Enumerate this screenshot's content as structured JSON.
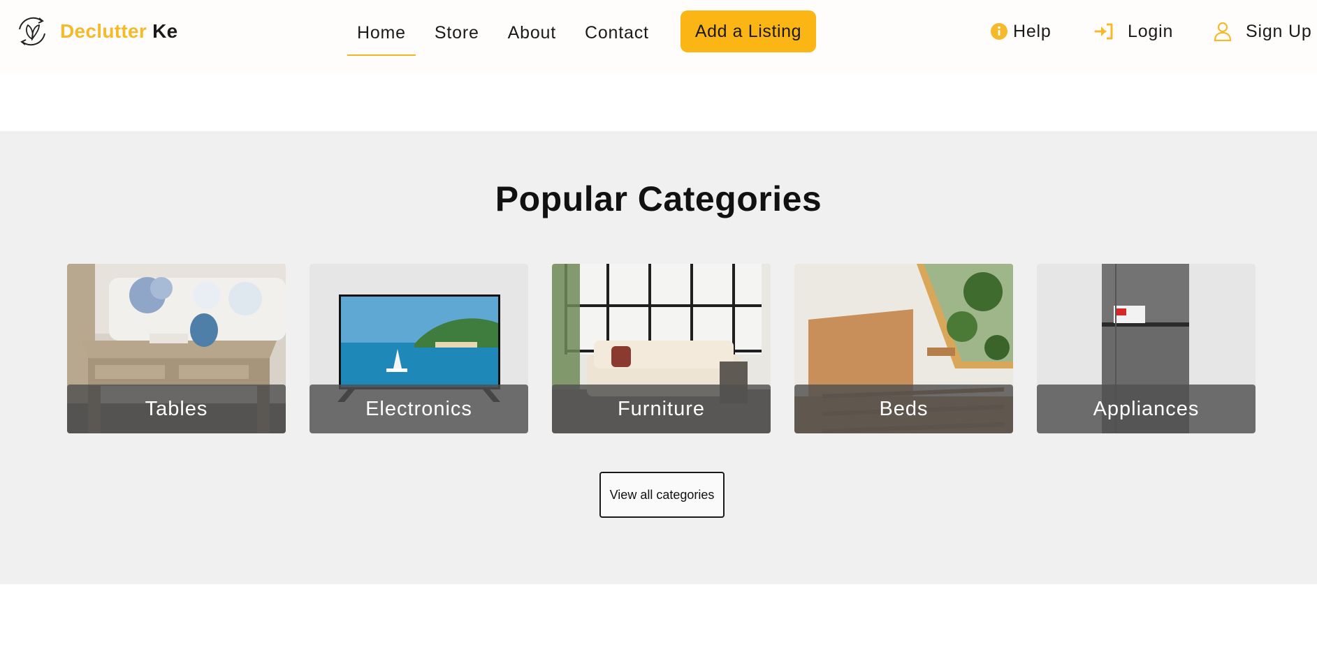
{
  "brand": {
    "name_accent": "Declutter",
    "name_rest": " Ke",
    "accent_color": "#f5b92a"
  },
  "nav": {
    "items": [
      {
        "label": "Home",
        "active": true
      },
      {
        "label": "Store",
        "active": false
      },
      {
        "label": "About",
        "active": false
      },
      {
        "label": "Contact",
        "active": false
      }
    ],
    "cta_label": "Add a Listing"
  },
  "right_links": {
    "help": "Help",
    "login": "Login",
    "signup": "Sign Up"
  },
  "categories": {
    "title": "Popular Categories",
    "items": [
      {
        "label": "Tables",
        "image": "coffee-table-photo"
      },
      {
        "label": "Electronics",
        "image": "tv-photo"
      },
      {
        "label": "Furniture",
        "image": "sofa-photo"
      },
      {
        "label": "Beds",
        "image": "bed-frame-photo"
      },
      {
        "label": "Appliances",
        "image": "fridge-photo"
      }
    ],
    "view_all_label": "View all categories"
  }
}
